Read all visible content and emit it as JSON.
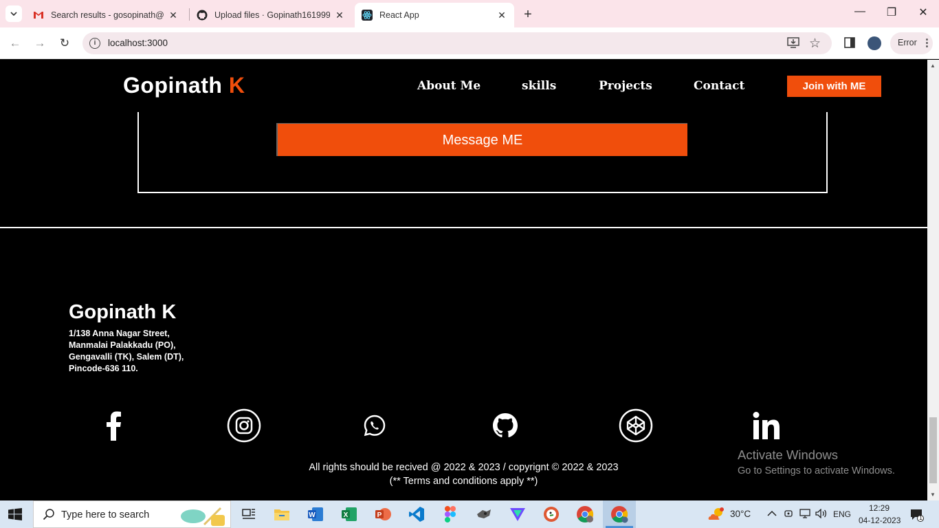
{
  "browser": {
    "tabs": [
      {
        "title": "Search results - gosopinath@g",
        "icon": "gmail-icon"
      },
      {
        "title": "Upload files · Gopinath161999/",
        "icon": "github-icon"
      },
      {
        "title": "React App",
        "icon": "react-icon",
        "active": true
      }
    ],
    "url": "localhost:3000",
    "error_label": "Error"
  },
  "site": {
    "brand_first": "Gopinath",
    "brand_accent": "K",
    "nav": [
      "About Me",
      "skills",
      "Projects",
      "Contact"
    ],
    "join_label": "Join with ME",
    "message_label": "Message ME",
    "accent_color": "#f04e0c"
  },
  "footer": {
    "name": "Gopinath K",
    "address": [
      "1/138 Anna Nagar Street,",
      "Manmalai Palakkadu (PO),",
      "Gengavalli (TK), Salem (DT),",
      "Pincode-636 110."
    ],
    "social_icons": [
      "facebook-icon",
      "instagram-icon",
      "whatsapp-icon",
      "github-icon",
      "codepen-icon",
      "linkedin-icon"
    ],
    "copyright_line1": "All rights should be recived @ 2022 & 2023 / copyrignt © 2022 & 2023",
    "copyright_line2": "(** Terms and conditions apply **)"
  },
  "watermark": {
    "line1": "Activate Windows",
    "line2": "Go to Settings to activate Windows."
  },
  "taskbar": {
    "search_placeholder": "Type here to search",
    "temperature": "30°C",
    "language": "ENG",
    "time": "12:29",
    "date": "04-12-2023",
    "notification_count": "1"
  }
}
